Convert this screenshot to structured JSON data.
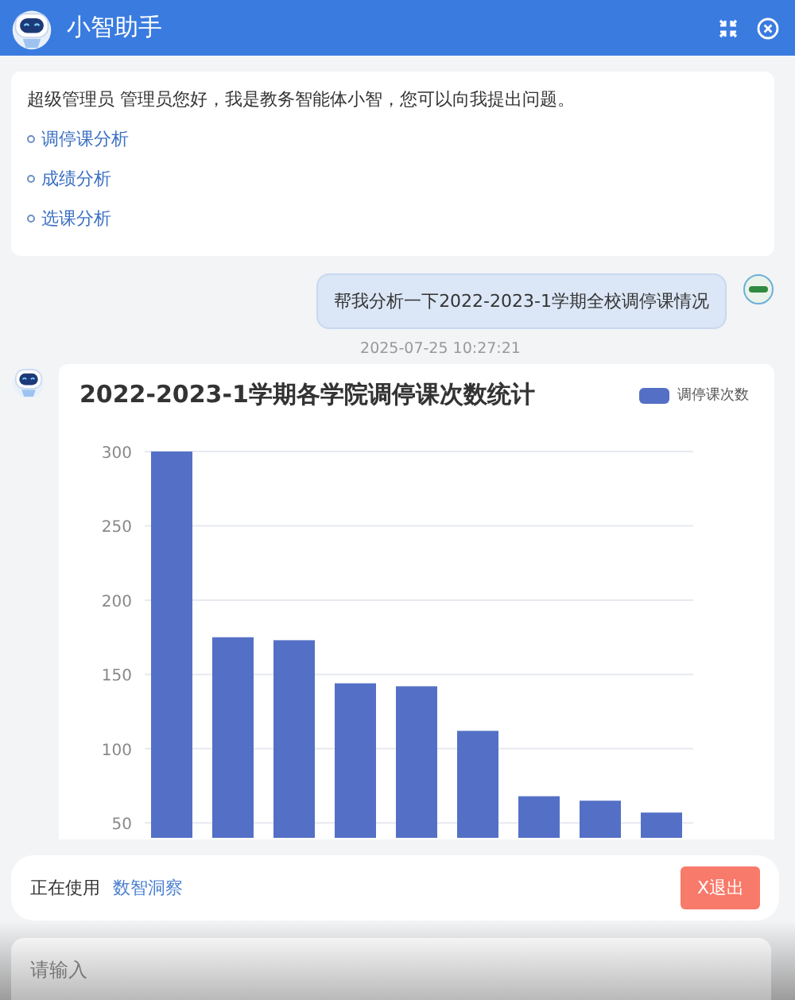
{
  "window": {
    "title": "小智助手"
  },
  "welcome": {
    "text": "超级管理员 管理员您好，我是教务智能体小智，您可以向我提出问题。",
    "suggestions": [
      "调停课分析",
      "成绩分析",
      "选课分析"
    ]
  },
  "user_message": {
    "text": "帮我分析一下2022-2023-1学期全校调停课情况",
    "time": "2025-07-25 10:27:21"
  },
  "bot_message": {
    "chart_data": {
      "type": "bar",
      "title": "2022-2023-1学期各学院调停课次数统计",
      "series": [
        {
          "name": "调停课次数",
          "color": "#5470c6",
          "values": [
            300,
            175,
            173,
            144,
            142,
            112,
            68,
            65,
            57
          ]
        }
      ],
      "ylim": [
        40,
        300
      ],
      "grid": true,
      "yticks": [
        50,
        100,
        150,
        200,
        250,
        300
      ]
    }
  },
  "status_bar": {
    "label": "正在使用",
    "tool": "数智洞察",
    "exit_button": "X退出"
  },
  "input": {
    "placeholder": "请输入"
  }
}
